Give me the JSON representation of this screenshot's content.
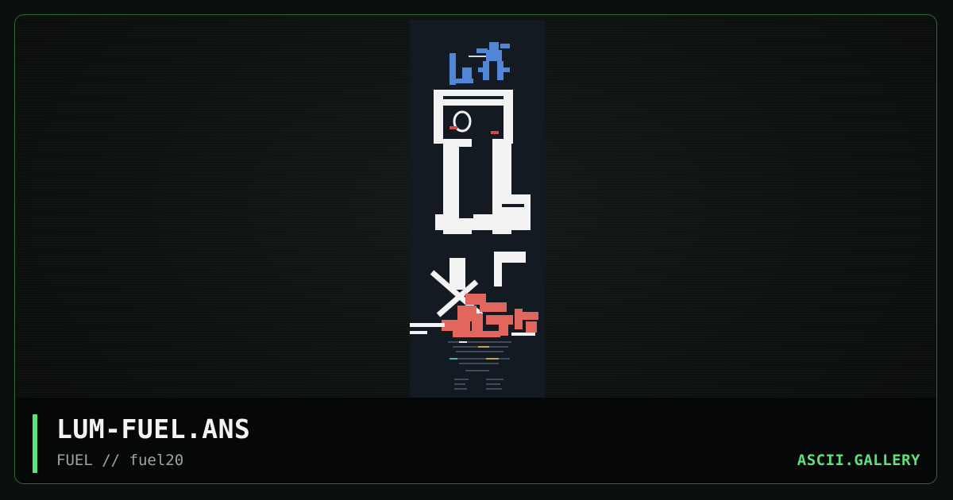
{
  "artwork": {
    "filename": "LUM-FUEL.ANS",
    "group": "FUEL",
    "separator": "//",
    "pack": "fuel20",
    "byline": "FUEL // fuel20"
  },
  "site": {
    "name": "ASCII.GALLERY"
  },
  "colors": {
    "accent": "#5ee07a",
    "frame_border": "#2f6a34",
    "art_background": "#141a22",
    "art_white": "#f3f3f3",
    "art_salmon": "#e0665e",
    "art_blue": "#4f86d6"
  },
  "icons": {
    "accent_bar": "vertical-green-bar"
  }
}
